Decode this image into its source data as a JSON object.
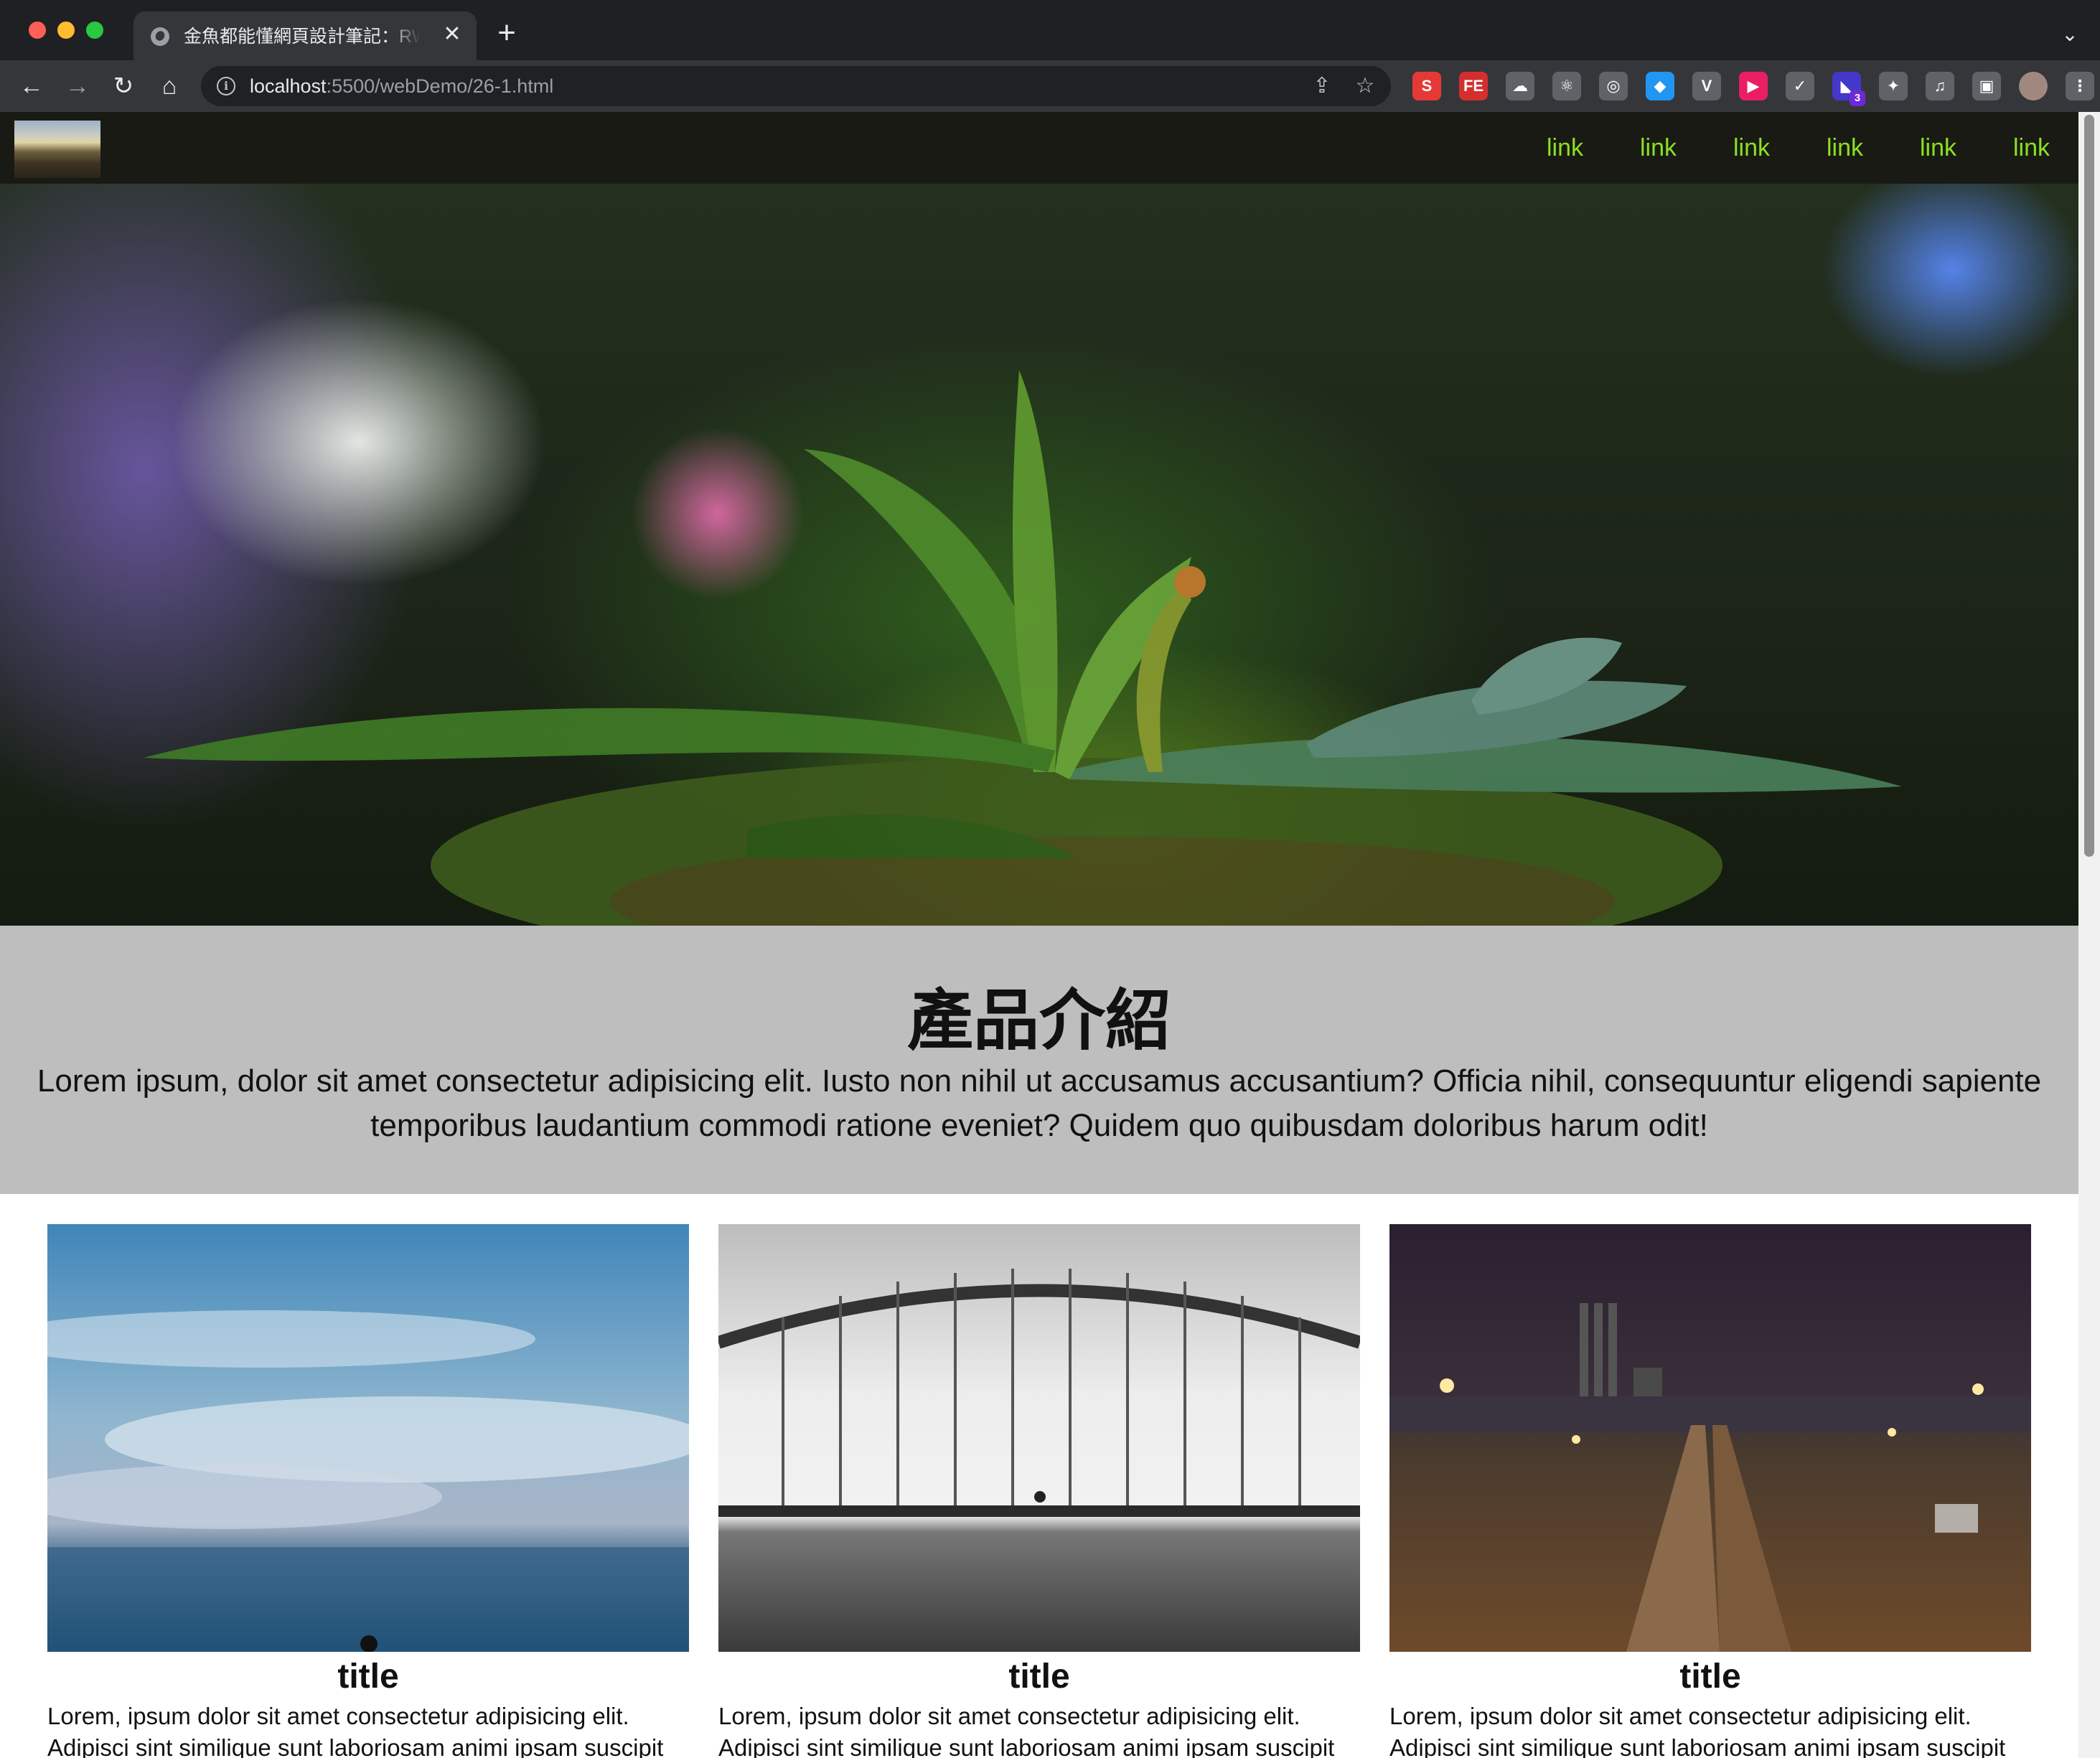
{
  "browser": {
    "tab_title": "金魚都能懂網頁設計筆記：RWD版面",
    "tab_close": "✕",
    "new_tab": "+",
    "tab_menu": "⌄",
    "url_host": "localhost",
    "url_path": ":5500/webDemo/26-1.html",
    "nav_icons": [
      "back-arrow-icon",
      "forward-arrow-icon",
      "reload-icon",
      "home-icon"
    ],
    "extensions": [
      {
        "name": "s-extension-icon",
        "label": "S",
        "color": "#e53935"
      },
      {
        "name": "fe-extension-icon",
        "label": "FE",
        "color": "#d32f2f"
      },
      {
        "name": "cloud-extension-icon",
        "label": "☁",
        "color": "#5f6368"
      },
      {
        "name": "react-devtools-icon",
        "label": "⚛",
        "color": "#5f6368"
      },
      {
        "name": "target-extension-icon",
        "label": "◎",
        "color": "#5f6368"
      },
      {
        "name": "gem-extension-icon",
        "label": "◆",
        "color": "#2196f3"
      },
      {
        "name": "vue-devtools-icon",
        "label": "V",
        "color": "#5f6368"
      },
      {
        "name": "play-extension-icon",
        "label": "▶",
        "color": "#e91e63"
      },
      {
        "name": "check-extension-icon",
        "label": "✓",
        "color": "#5f6368"
      },
      {
        "name": "layers-extension-icon",
        "label": "◣",
        "color": "#4338ca",
        "badge": "3"
      },
      {
        "name": "extensions-puzzle-icon",
        "label": "✦",
        "color": "#5f6368"
      },
      {
        "name": "media-control-icon",
        "label": "♫",
        "color": "#5f6368"
      },
      {
        "name": "side-panel-icon",
        "label": "▣",
        "color": "#5f6368"
      },
      {
        "name": "profile-avatar-icon",
        "label": "",
        "color": "#a1887f"
      },
      {
        "name": "chrome-menu-icon",
        "label": "⋮",
        "color": "#5f6368"
      }
    ]
  },
  "page": {
    "nav_links": [
      "link",
      "link",
      "link",
      "link",
      "link",
      "link"
    ],
    "intro": {
      "title": "產品介紹",
      "text": "Lorem ipsum, dolor sit amet consectetur adipisicing elit. Iusto non nihil ut accusamus accusantium? Officia nihil, consequuntur eligendi sapiente temporibus laudantium commodi ratione eveniet? Quidem quo quibusdam doloribus harum odit!"
    },
    "cards": [
      {
        "title": "title",
        "text": "Lorem, ipsum dolor sit amet consectetur adipisicing elit. Adipisci sint similique sunt laboriosam animi ipsam suscipit"
      },
      {
        "title": "title",
        "text": "Lorem, ipsum dolor sit amet consectetur adipisicing elit. Adipisci sint similique sunt laboriosam animi ipsam suscipit"
      },
      {
        "title": "title",
        "text": "Lorem, ipsum dolor sit amet consectetur adipisicing elit. Adipisci sint similique sunt laboriosam animi ipsam suscipit"
      }
    ],
    "colors": {
      "nav_bg": "#1a1a14",
      "nav_link": "#8be025",
      "intro_bg": "#bebebe"
    }
  }
}
